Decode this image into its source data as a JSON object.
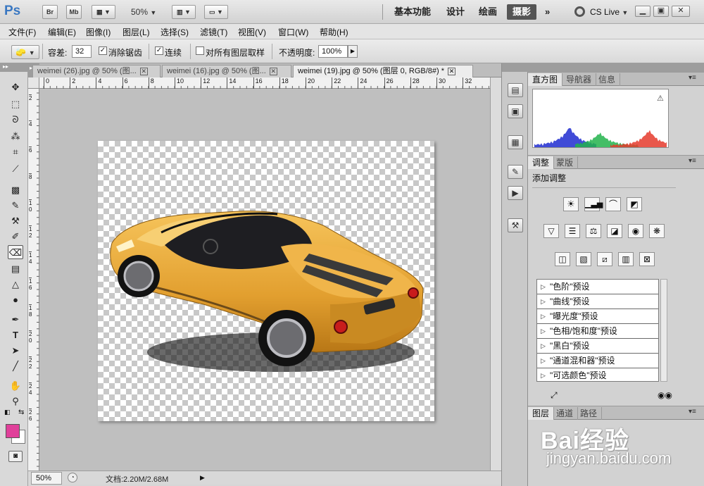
{
  "app": {
    "logo": "Ps",
    "bridge_button": "Br",
    "minibridge_button": "Mb",
    "zoom": "50%",
    "workspaces": [
      "基本功能",
      "设计",
      "绘画",
      "摄影"
    ],
    "active_workspace": "摄影",
    "more_workspaces": "»",
    "cs_live": "CS Live"
  },
  "menu": [
    "文件(F)",
    "编辑(E)",
    "图像(I)",
    "图层(L)",
    "选择(S)",
    "滤镜(T)",
    "视图(V)",
    "窗口(W)",
    "帮助(H)"
  ],
  "options": {
    "tolerance_label": "容差:",
    "tolerance_value": "32",
    "antialias_label": "消除锯齿",
    "contiguous_label": "连续",
    "sample_all_label": "对所有图层取样",
    "opacity_label": "不透明度:",
    "opacity_value": "100%"
  },
  "documents": {
    "tabs": [
      {
        "label": "weimei (26).jpg @ 50% (图..."
      },
      {
        "label": "weimei (16).jpg @ 50% (图..."
      },
      {
        "label": "weimei (19).jpg @ 50% (图层 0, RGB/8#) *"
      }
    ],
    "active_index": 2
  },
  "ruler": {
    "top_labels": [
      "0",
      "2",
      "4",
      "6",
      "8",
      "10",
      "12",
      "14",
      "16",
      "18",
      "20",
      "22",
      "24",
      "26",
      "28",
      "30",
      "32"
    ],
    "left_labels": [
      "2",
      "4",
      "6",
      "8",
      "1\n0",
      "1\n2",
      "1\n4",
      "1\n6",
      "1\n8",
      "2\n0",
      "2\n2",
      "2\n4",
      "2\n6"
    ]
  },
  "status": {
    "zoom": "50%",
    "doc_size": "文档:2.20M/2.68M"
  },
  "panels": {
    "top_tabs": [
      "直方图",
      "导航器",
      "信息"
    ],
    "adjust_tabs": [
      "调整",
      "蒙版"
    ],
    "adjust_title": "添加调整",
    "presets": [
      "\"色阶\"预设",
      "\"曲线\"预设",
      "\"曝光度\"预设",
      "\"色相/饱和度\"预设",
      "\"黑白\"预设",
      "\"通道混和器\"预设",
      "\"可选颜色\"预设"
    ],
    "bottom_tabs": [
      "图层",
      "通道",
      "路径"
    ]
  },
  "colors": {
    "foreground": "#e0409a",
    "background": "#ffffff",
    "car_body": "#e9a93a",
    "histogram": [
      "#1f2bd0",
      "#22b34b",
      "#e53a2b"
    ]
  },
  "watermark": {
    "logo": "Bai经验",
    "url": "jingyan.baidu.com"
  }
}
